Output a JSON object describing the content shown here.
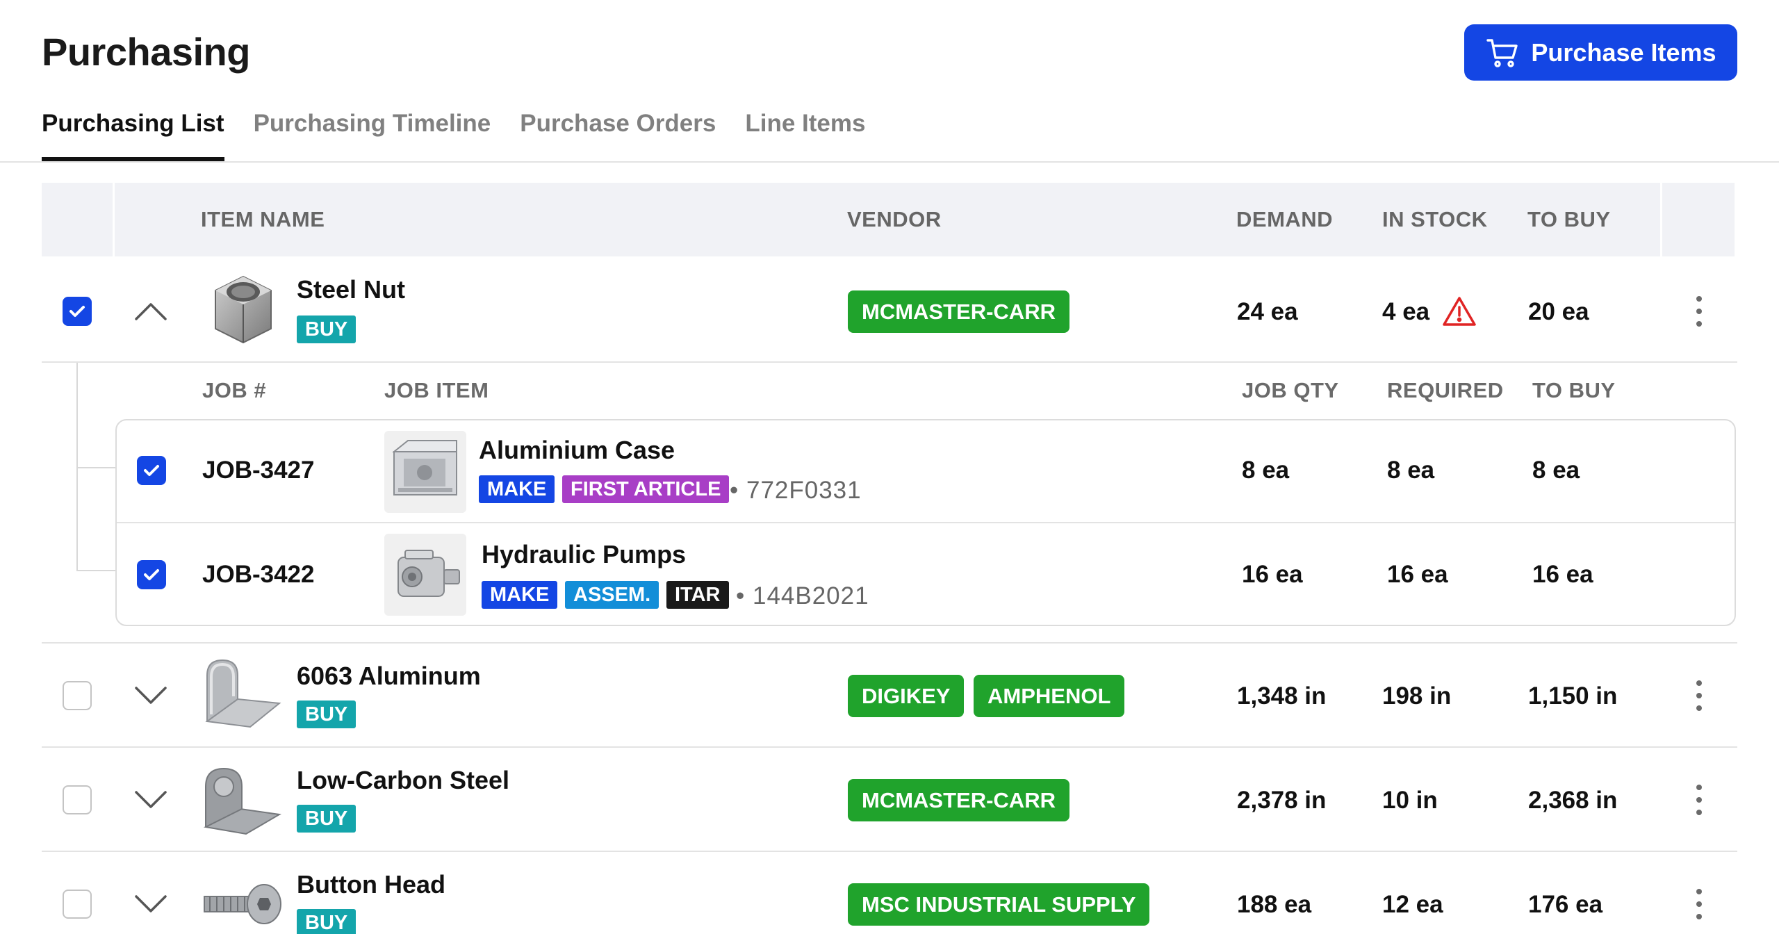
{
  "page": {
    "title": "Purchasing"
  },
  "actions": {
    "purchase_label": "Purchase Items"
  },
  "tabs": [
    {
      "label": "Purchasing List",
      "active": true
    },
    {
      "label": "Purchasing Timeline",
      "active": false
    },
    {
      "label": "Purchase Orders",
      "active": false
    },
    {
      "label": "Line Items",
      "active": false
    }
  ],
  "table": {
    "headers": {
      "item_name": "ITEM NAME",
      "vendor": "VENDOR",
      "demand": "DEMAND",
      "in_stock": "IN STOCK",
      "to_buy": "TO BUY"
    },
    "rows": [
      {
        "name": "Steel Nut",
        "tag": "BUY",
        "vendors": [
          "MCMASTER-CARR"
        ],
        "demand": "24 ea",
        "in_stock": "4 ea",
        "to_buy": "20 ea",
        "checked": true,
        "expanded": true,
        "low_stock_warning": true,
        "icon": "hex-nut-icon"
      },
      {
        "name": "6063 Aluminum",
        "tag": "BUY",
        "vendors": [
          "DIGIKEY",
          "AMPHENOL"
        ],
        "demand": "1,348 in",
        "in_stock": "198 in",
        "to_buy": "1,150 in",
        "checked": false,
        "expanded": false,
        "icon": "aluminum-sheet-icon"
      },
      {
        "name": "Low-Carbon Steel",
        "tag": "BUY",
        "vendors": [
          "MCMASTER-CARR"
        ],
        "demand": "2,378 in",
        "in_stock": "10 in",
        "to_buy": "2,368 in",
        "checked": false,
        "expanded": false,
        "icon": "steel-sheet-icon"
      },
      {
        "name": "Button Head",
        "tag": "BUY",
        "vendors": [
          "MSC INDUSTRIAL SUPPLY"
        ],
        "demand": "188 ea",
        "in_stock": "12 ea",
        "to_buy": "176 ea",
        "checked": false,
        "expanded": false,
        "icon": "button-head-screw-icon"
      }
    ]
  },
  "sub_table": {
    "headers": {
      "job": "JOB #",
      "job_item": "JOB ITEM",
      "job_qty": "JOB QTY",
      "required": "REQUIRED",
      "to_buy": "TO BUY"
    },
    "rows": [
      {
        "job": "JOB-3427",
        "item": "Aluminium Case",
        "tags": [
          "MAKE",
          "FIRST ARTICLE"
        ],
        "part_no": "• 772F0331",
        "job_qty": "8 ea",
        "required": "8 ea",
        "to_buy": "8 ea",
        "checked": true,
        "icon": "aluminium-case-icon"
      },
      {
        "job": "JOB-3422",
        "item": "Hydraulic Pumps",
        "tags": [
          "MAKE",
          "ASSEM.",
          "ITAR"
        ],
        "part_no": "• 144B2021",
        "job_qty": "16 ea",
        "required": "16 ea",
        "to_buy": "16 ea",
        "checked": true,
        "icon": "hydraulic-pump-icon"
      }
    ]
  },
  "colors": {
    "accent": "#1446e4",
    "vendor": "#20a32c",
    "buy_tag": "#14a5ab",
    "warning": "#e02424"
  }
}
